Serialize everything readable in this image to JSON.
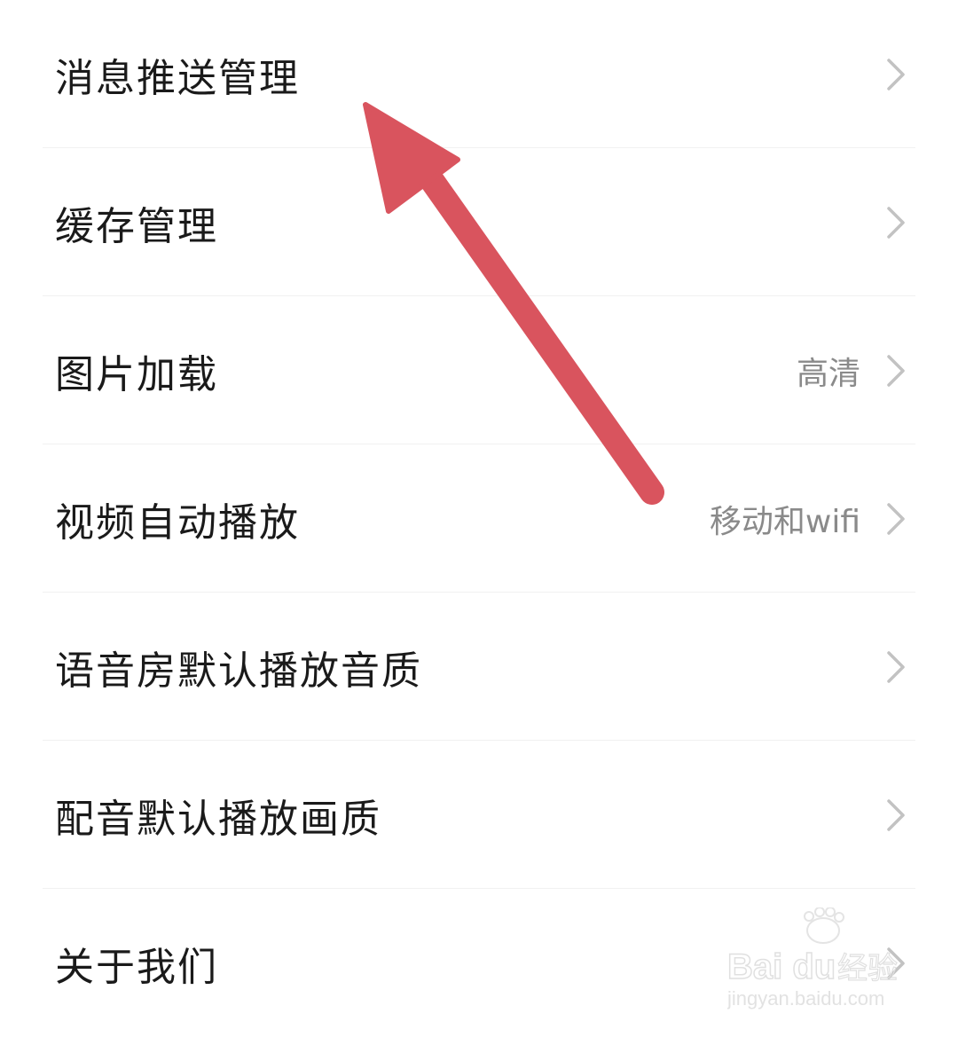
{
  "settings": {
    "items": [
      {
        "label": "消息推送管理",
        "value": ""
      },
      {
        "label": "缓存管理",
        "value": ""
      },
      {
        "label": "图片加载",
        "value": "高清"
      },
      {
        "label": "视频自动播放",
        "value": "移动和wifi"
      },
      {
        "label": "语音房默认播放音质",
        "value": ""
      },
      {
        "label": "配音默认播放画质",
        "value": ""
      },
      {
        "label": "关于我们",
        "value": ""
      }
    ]
  },
  "icons": {
    "row_chevron": "chevron-right-icon",
    "annotation": "arrow-icon"
  },
  "colors": {
    "label_text": "#1a1a1a",
    "value_text": "#8a8a8a",
    "chevron": "#c2c2c2",
    "divider": "#f1f1f1",
    "annotation_arrow": "#d9545e"
  },
  "watermark": {
    "brand": "Baidu经验",
    "url": "jingyan.baidu.com"
  }
}
